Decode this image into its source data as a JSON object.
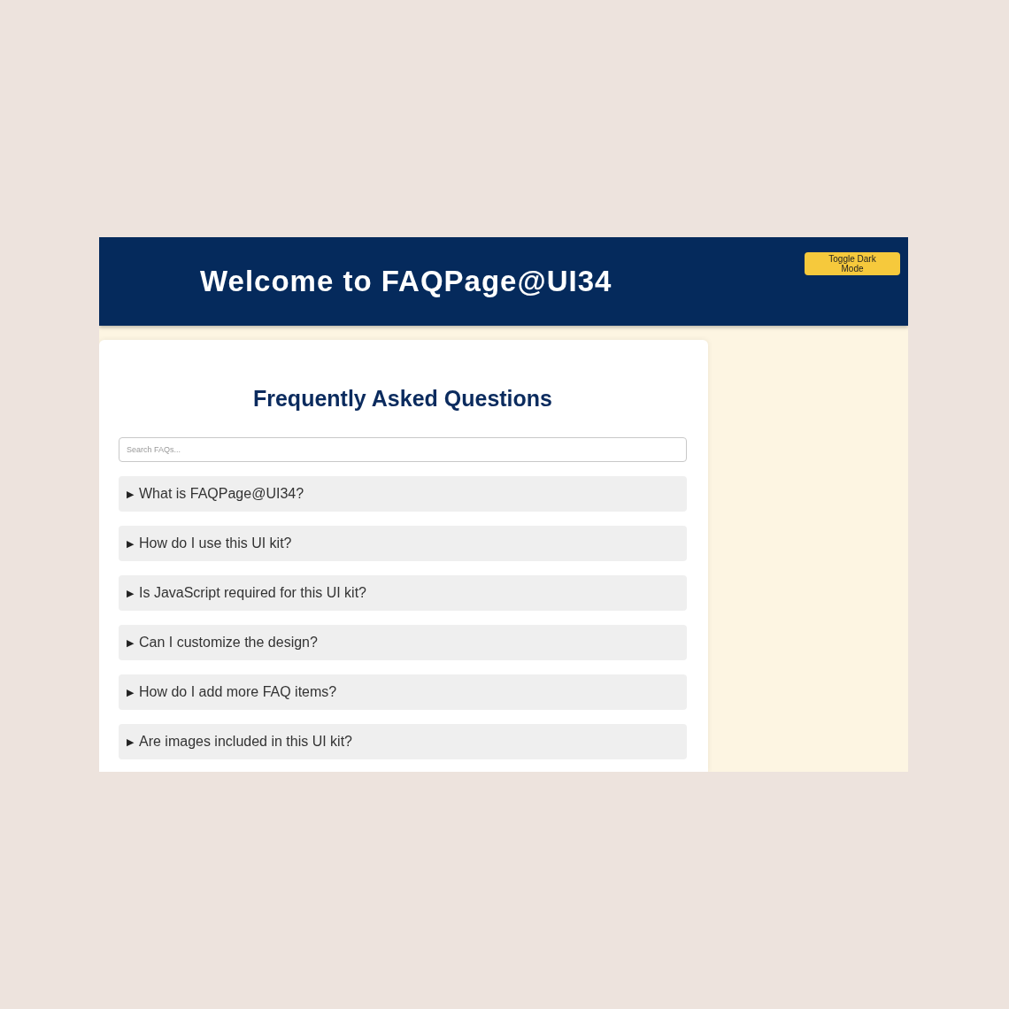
{
  "header": {
    "title": "Welcome to FAQPage@UI34",
    "toggle_button": "Toggle Dark Mode"
  },
  "faq": {
    "heading": "Frequently Asked Questions",
    "search": {
      "placeholder": "Search FAQs..."
    },
    "items": [
      {
        "icon": "▶",
        "question": "What is FAQPage@UI34?"
      },
      {
        "icon": "▶",
        "question": "How do I use this UI kit?"
      },
      {
        "icon": "▶",
        "question": "Is JavaScript required for this UI kit?"
      },
      {
        "icon": "▶",
        "question": "Can I customize the design?"
      },
      {
        "icon": "▶",
        "question": "How do I add more FAQ items?"
      },
      {
        "icon": "▶",
        "question": "Are images included in this UI kit?"
      }
    ]
  }
}
